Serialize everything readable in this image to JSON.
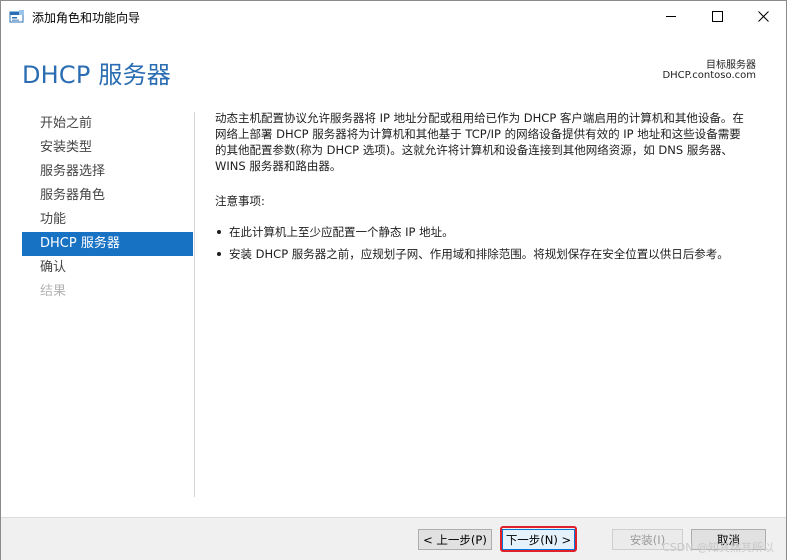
{
  "window": {
    "title": "添加角色和功能向导",
    "controls": [
      "minimize",
      "maximize",
      "close"
    ]
  },
  "header": {
    "page_title": "DHCP 服务器",
    "destination_label": "目标服务器",
    "destination_server": "DHCP.contoso.com"
  },
  "nav": {
    "items": [
      {
        "label": "开始之前",
        "state": "normal"
      },
      {
        "label": "安装类型",
        "state": "normal"
      },
      {
        "label": "服务器选择",
        "state": "normal"
      },
      {
        "label": "服务器角色",
        "state": "normal"
      },
      {
        "label": "功能",
        "state": "normal"
      },
      {
        "label": "DHCP 服务器",
        "state": "active"
      },
      {
        "label": "确认",
        "state": "normal"
      },
      {
        "label": "结果",
        "state": "disabled"
      }
    ]
  },
  "content": {
    "intro_lines": [
      "动态主机配置协议允许服务器将 IP 地址分配或租用给已作为 DHCP 客户端启用的计算机和其他设备。在",
      "网络上部署 DHCP 服务器将为计算机和其他基于 TCP/IP 的网络设备提供有效的 IP 地址和这些设备需要",
      "的其他配置参数(称为 DHCP 选项)。这就允许将计算机和设备连接到其他网络资源，如 DNS 服务器、",
      "WINS 服务器和路由器。"
    ],
    "notes_heading": "注意事项:",
    "notes": [
      "在此计算机上至少应配置一个静态 IP 地址。",
      "安装 DHCP 服务器之前，应规划子网、作用域和排除范围。将规划保存在安全位置以供日后参考。"
    ]
  },
  "footer": {
    "prev_label": "< 上一步(P)",
    "next_label": "下一步(N) >",
    "install_label": "安装(I)",
    "cancel_label": "取消"
  },
  "watermark": "CSDN @知其然其所以",
  "colors": {
    "accent": "#1872c3",
    "title_blue": "#2a6db2",
    "highlight_red": "#e0202a"
  }
}
